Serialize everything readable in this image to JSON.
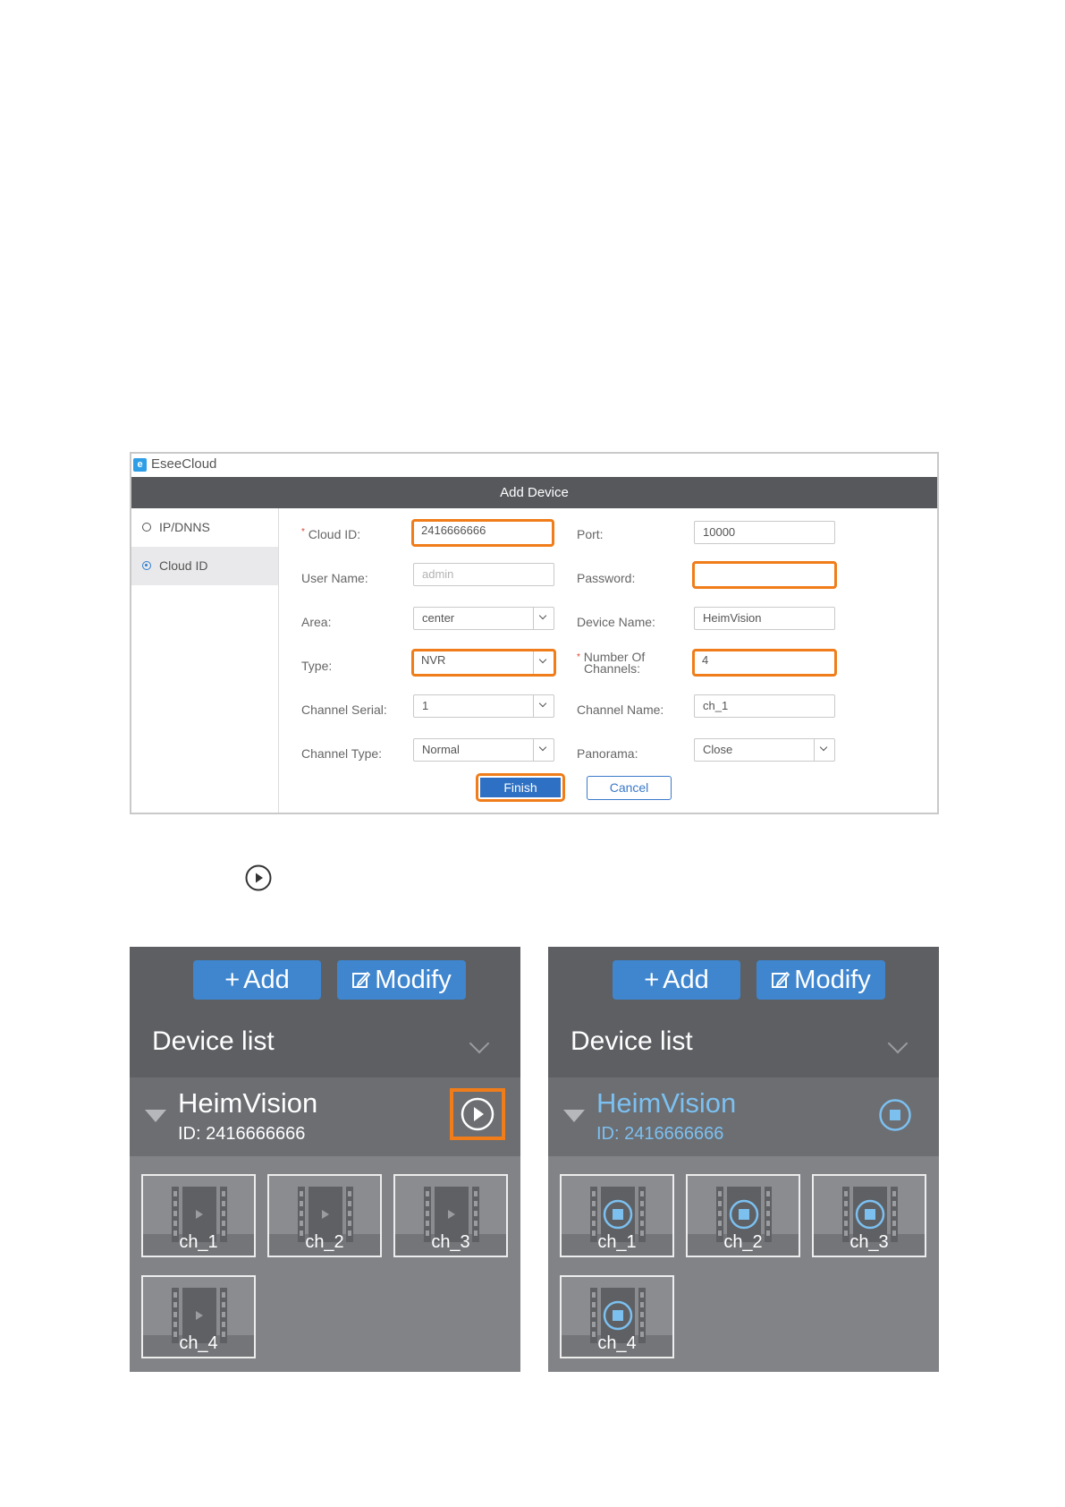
{
  "window": {
    "app_title": "EseeCloud",
    "dialog_title": "Add Device"
  },
  "sidebar": {
    "items": [
      {
        "label": "IP/DNNS",
        "selected": false
      },
      {
        "label": "Cloud ID",
        "selected": true
      }
    ]
  },
  "form": {
    "cloud_id": {
      "label": "Cloud ID:",
      "value": "2416666666",
      "required": true
    },
    "port": {
      "label": "Port:",
      "value": "10000"
    },
    "user_name": {
      "label": "User Name:",
      "placeholder": "admin",
      "value": ""
    },
    "password": {
      "label": "Password:",
      "value": ""
    },
    "area": {
      "label": "Area:",
      "value": "center"
    },
    "device_name": {
      "label": "Device Name:",
      "value": "HeimVision"
    },
    "type": {
      "label": "Type:",
      "value": "NVR"
    },
    "channels": {
      "label_line1": "Number Of",
      "label_line2": "Channels:",
      "value": "4",
      "required": true
    },
    "channel_serial": {
      "label": "Channel Serial:",
      "value": "1"
    },
    "channel_name": {
      "label": "Channel Name:",
      "value": "ch_1"
    },
    "channel_type": {
      "label": "Channel Type:",
      "value": "Normal"
    },
    "panorama": {
      "label": "Panorama:",
      "value": "Close"
    },
    "required_mark": "*",
    "finish_label": "Finish",
    "cancel_label": "Cancel"
  },
  "panels": [
    {
      "add_label": "Add",
      "modify_label": "Modify",
      "list_title": "Device list",
      "device_name": "HeimVision",
      "device_id": "ID: 2416666666",
      "state": "stopped",
      "channels": [
        "ch_1",
        "ch_2",
        "ch_3",
        "ch_4"
      ]
    },
    {
      "add_label": "Add",
      "modify_label": "Modify",
      "list_title": "Device list",
      "device_name": "HeimVision",
      "device_id": "ID: 2416666666",
      "state": "playing",
      "channels": [
        "ch_1",
        "ch_2",
        "ch_3",
        "ch_4"
      ]
    }
  ],
  "colors": {
    "highlight": "#f07d1a",
    "accent": "#3f86cf",
    "header": "#56585c",
    "playing_text": "#7cc0f0"
  }
}
